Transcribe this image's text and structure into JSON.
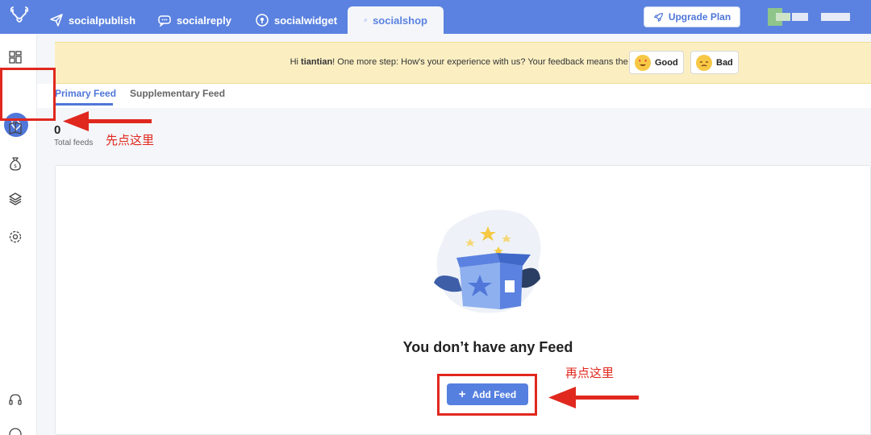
{
  "topnav": {
    "tabs": [
      {
        "label": "socialpublish",
        "icon": "paper-plane-icon"
      },
      {
        "label": "socialreply",
        "icon": "chat-bubble-icon"
      },
      {
        "label": "socialwidget",
        "icon": "location-pin-icon"
      },
      {
        "label": "socialshop",
        "icon": "shopping-tag-icon"
      }
    ],
    "active_tab": "socialshop",
    "upgrade_label": "Upgrade Plan"
  },
  "sidebar": {
    "items": [
      "dashboard-icon",
      "tag-icon",
      "book-icon",
      "money-bag-icon",
      "layers-icon",
      "settings-icon",
      "headset-icon"
    ],
    "active_item": "tag-icon"
  },
  "banner": {
    "text_before": "Hi ",
    "username": "tiantian",
    "text_after": "! One more step: How's your experience with us? Your feedback means the world to us!",
    "good_label": "Good",
    "bad_label": "Bad"
  },
  "feed_tabs": {
    "primary": "Primary Feed",
    "supplementary": "Supplementary Feed"
  },
  "stats": {
    "total_feeds_value": "0",
    "total_feeds_label": "Total feeds"
  },
  "empty_state": {
    "title": "You don’t have any Feed",
    "add_button_label": "Add Feed",
    "add_button_icon": "+"
  },
  "annotations": {
    "first": "先点这里",
    "second": "再点这里"
  },
  "colors": {
    "brand_blue": "#5b82e0",
    "banner_yellow": "#fbefc2",
    "annotation_red": "#e0281e"
  }
}
